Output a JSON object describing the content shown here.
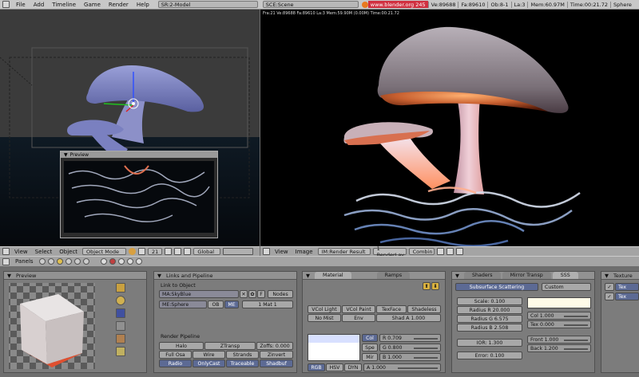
{
  "topbar": {
    "menus": [
      "File",
      "Add",
      "Timeline",
      "Game",
      "Render",
      "Help"
    ],
    "screen": "SR:2-Model",
    "scene": "SCE:Scene",
    "url": "www.blender.org 245",
    "stats": [
      "Ve:89688",
      "Fa:89610",
      "Ob:8-1",
      "La:3",
      "Mem:60.97M",
      "Time:00:21.72",
      "Sphere"
    ]
  },
  "render_stats": "Fra:21  Ve:89688 Fa:89610 La:3 Mem:59.90M (0.00M) Time:00:21.72",
  "preview_window": {
    "title": "Preview"
  },
  "view3d_header": {
    "menus": [
      "View",
      "Select",
      "Object"
    ],
    "mode": "Object Mode",
    "layer": "21",
    "orientation": "Global"
  },
  "image_header": {
    "menus": [
      "View",
      "Image"
    ],
    "image": "IM:Render Result",
    "layer": "1 RenderLay",
    "pass": "Combin"
  },
  "buttons_header": {
    "menu": "Panels"
  },
  "preview_panel": {
    "title": "Preview"
  },
  "links_panel": {
    "title": "Links and Pipeline",
    "link_to_object": "Link to Object",
    "material": "MA:SkyBlue",
    "f_btn": "F",
    "nodes": "Nodes",
    "mesh": "ME:Sphere",
    "ob": "OB",
    "me": "ME",
    "mat_count": "1 Mat 1",
    "pipeline": "Render Pipeline",
    "halo": "Halo",
    "ztransp": "ZTransp",
    "zoffs": "Zoffs: 0.000",
    "full_osa": "Full Osa",
    "wire": "Wire",
    "strands": "Strands",
    "zinvert": "Zinvert",
    "radio": "Radio",
    "onlycast": "OnlyCast",
    "traceable": "Traceable",
    "shadbuf": "Shadbuf"
  },
  "material_panel": {
    "tab_material": "Material",
    "tab_ramps": "Ramps",
    "vcol_light": "VCol Light",
    "vcol_paint": "VCol Paint",
    "texface": "TexFace",
    "shadeless": "Shadeless",
    "no_mist": "No Mist",
    "env": "Env",
    "shad_a": "Shad A 1.000",
    "col": "Col",
    "spe": "Spe",
    "mir": "Mir",
    "r": "R 0.709",
    "g": "G 0.800",
    "b": "B 1.000",
    "rgb": "RGB",
    "hsv": "HSV",
    "dyn": "DYN",
    "a": "A 1.000"
  },
  "sss_panel": {
    "tab_shaders": "Shaders",
    "tab_mirror": "Mirror Transp",
    "tab_sss": "SSS",
    "sss_toggle": "Subsurface Scattering",
    "preset": "Custom",
    "scale": "Scale: 0.100",
    "radius_r": "Radius R 20.000",
    "radius_g": "Radius G 6.575",
    "radius_b": "Radius B 2.508",
    "ior": "IOR: 1.300",
    "error": "Error: 0.100",
    "col": "Col 1.000",
    "tex": "Tex 0.000",
    "front": "Front 1.000",
    "back": "Back 1.200"
  },
  "texture_panel": {
    "title": "Texture",
    "item1": "Tex",
    "item2": "Tex"
  }
}
